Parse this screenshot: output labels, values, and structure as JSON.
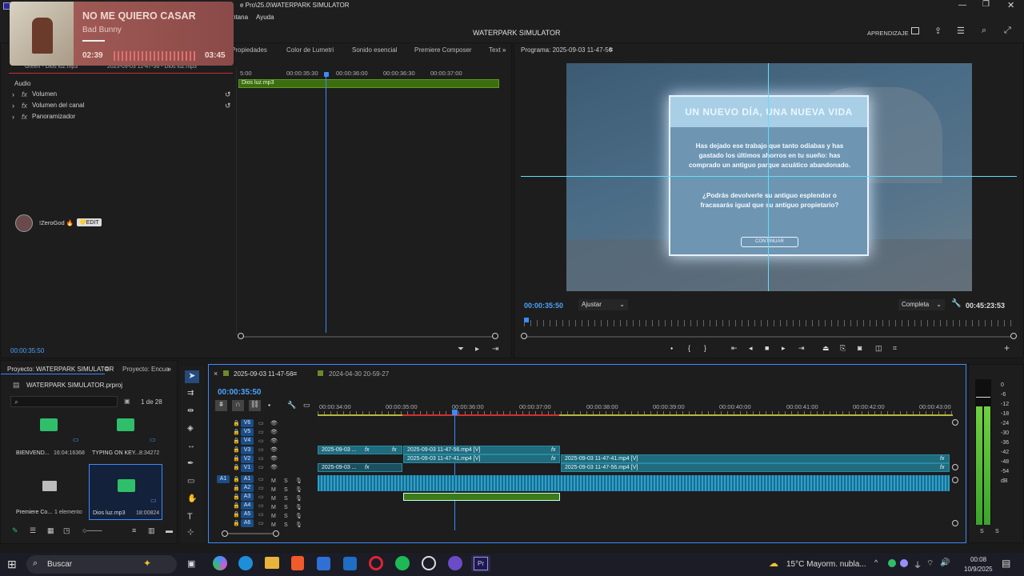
{
  "titlebar": {
    "text": "Adobe Premiere Pro\\25.0\\WATERPARK SIMULATOR",
    "partial": "e Pro\\25.0\\WATERPARK SIMULATOR"
  },
  "menubar": {
    "items": [
      "ntana",
      "Ayuda"
    ]
  },
  "header": {
    "project_title": "WATERPARK SIMULATOR",
    "learning": "APRENDIZAJE"
  },
  "media_overlay": {
    "title": "NO ME QUIERO CASAR",
    "artist": "Bad Bunny",
    "elapsed": "02:39",
    "duration": "03:45"
  },
  "source_panel": {
    "tabs": [
      "Propiedades",
      "Color de Lumetri",
      "Sonido esencial",
      "Premiere Composer",
      "Text"
    ],
    "clip_path": "2025-09-03 11-47-56 - Dios luz.mp3",
    "clip_prefix": "Green - Dios luz.mp3",
    "section": "Audio",
    "effects": [
      "Volumen",
      "Volumen del canal",
      "Panoramizador"
    ],
    "timecodes": [
      "5:00",
      "00:00:35:30",
      "00:00:36:00",
      "00:00:36:30",
      "00:00:37:00"
    ],
    "clip_label": "Dios luz.mp3",
    "current_time": "00:00:35:50"
  },
  "streamer": {
    "name": "!ZeroGod 🔥",
    "badge": "💛EDIT"
  },
  "program": {
    "tab": "Programa: 2025-09-03 11-47-56",
    "timecode": "00:00:35:50",
    "fit": "Ajustar",
    "quality": "Completa",
    "duration": "00:45:23:53",
    "dialog": {
      "title": "UN NUEVO DÍA, UNA NUEVA VIDA",
      "body1": "Has dejado ese trabajo que tanto odiabas y has gastado los últimos ahorros en tu sueño: has comprado un antiguo parque acuático abandonado.",
      "body2": "¿Podrás devolverle su antiguo esplendor o fracasarás igual que su antiguo propietario?",
      "button": "CONTINUAR"
    }
  },
  "project_panel": {
    "tab": "Proyecto: WATERPARK SIMULATOR",
    "tab2": "Proyecto: Encua",
    "file": "WATERPARK SIMULATOR.prproj",
    "count": "1 de 28",
    "items": [
      {
        "name": "BIENVEND...",
        "meta": "16:04:16368"
      },
      {
        "name": "TYPING ON KEY...",
        "meta": "8:34272"
      },
      {
        "name": "Premiere Co...",
        "meta": "1 elemento"
      },
      {
        "name": "Dios luz.mp3",
        "meta": "18:00824"
      }
    ]
  },
  "timeline": {
    "tabs": [
      "2025-09-03 11-47-56",
      "2024-04-30 20-59-27"
    ],
    "timecode": "00:00:35:50",
    "ruler": [
      "00:00:34:00",
      "00:00:35:00",
      "00:00:36:00",
      "00:00:37:00",
      "00:00:38:00",
      "00:00:39:00",
      "00:00:40:00",
      "00:00:41:00",
      "00:00:42:00",
      "00:00:43:00"
    ],
    "video_tracks": [
      "V6",
      "V5",
      "V4",
      "V3",
      "V2",
      "V1"
    ],
    "audio_tracks": [
      "A1",
      "A2",
      "A3",
      "A4",
      "A5",
      "A6"
    ],
    "src_a": "A1",
    "clips": {
      "v3a": "2025-09-03 ...",
      "v3b": "2025-09-03 11-47-56.mp4 [V]",
      "v2a": "2025-09-03 11-47-41.mp4 [V]",
      "v2b": "2025-09-03 11-47-41.mp4 [V]",
      "v1a": "2025-09-03 ...",
      "v1b": "2025-09-03 11-47-56.mp4 [V]",
      "fx": "fx"
    },
    "track_btns": {
      "m": "M",
      "s": "S"
    }
  },
  "meter": {
    "scale": [
      "0",
      "-6",
      "-12",
      "-18",
      "-24",
      "-30",
      "-36",
      "-42",
      "-48",
      "-54",
      "dB"
    ],
    "ss": [
      "S",
      "S"
    ]
  },
  "taskbar": {
    "search": "Buscar",
    "weather": "15°C  Mayorm. nubla...",
    "time": "00:08",
    "date": "10/9/2025"
  }
}
